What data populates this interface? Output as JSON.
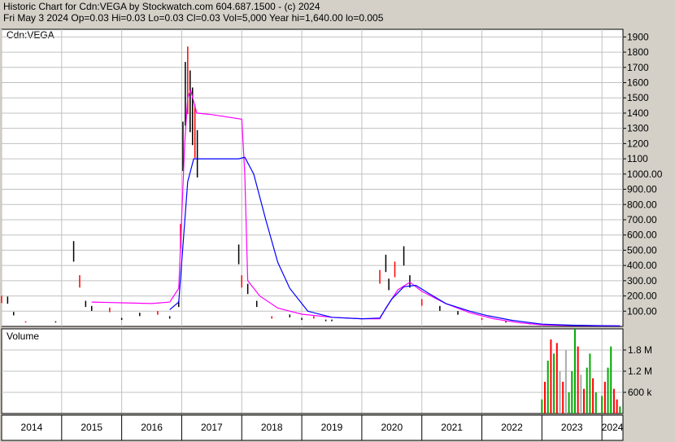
{
  "header": {
    "line1": "Historic Chart for Cdn:VEGA by Stockwatch.com 604.687.1500 - (c) 2024",
    "line2": "Fri May  3 2024   Op=0.03  Hi=0.03  Lo=0.03  Cl=0.03  Vol=5,000   Year hi=1,640.00  lo=0.005"
  },
  "colors": {
    "page_bg": "#d4d0c8",
    "plot_bg": "#ffffff",
    "grid": "#c0c0c0",
    "price_bar": "#000000",
    "price_bar_down": "#ff0000",
    "ma_short": "#ff00ff",
    "ma_long": "#0000ff",
    "volume_up": "#00aa00",
    "volume_down": "#ff0000",
    "volume_flat": "#aaaaaa"
  },
  "chart_data": [
    {
      "type": "line",
      "title": "Cdn:VEGA",
      "x_tick_labels": [
        "2014",
        "2015",
        "2016",
        "2017",
        "2018",
        "2019",
        "2020",
        "2021",
        "2022",
        "2023",
        "2024"
      ],
      "x_range": [
        2014.0,
        2024.35
      ],
      "y_tick_labels": [
        "1900",
        "1800",
        "1700",
        "1600",
        "1500",
        "1400",
        "1300",
        "1200",
        "1100",
        "1000.00",
        "900.00",
        "800.00",
        "700.00",
        "600.00",
        "500.00",
        "400.00",
        "300.00",
        "200.00",
        "100.00"
      ],
      "ylim": [
        0,
        1950
      ],
      "grid": true,
      "series": [
        {
          "style": "ohlc-bars",
          "points": [
            [
              2014.0,
              180
            ],
            [
              2014.1,
              175
            ],
            [
              2014.2,
              85
            ],
            [
              2014.4,
              30
            ],
            [
              2014.9,
              30
            ],
            [
              2015.2,
              500
            ],
            [
              2015.3,
              300
            ],
            [
              2015.4,
              150
            ],
            [
              2015.5,
              120
            ],
            [
              2015.8,
              110
            ],
            [
              2016.0,
              50
            ],
            [
              2016.3,
              80
            ],
            [
              2016.6,
              90
            ],
            [
              2016.8,
              60
            ],
            [
              2016.95,
              150
            ],
            [
              2016.98,
              600
            ],
            [
              2017.02,
              1200
            ],
            [
              2017.06,
              1550
            ],
            [
              2017.1,
              1640
            ],
            [
              2017.14,
              1500
            ],
            [
              2017.18,
              1400
            ],
            [
              2017.22,
              1300
            ],
            [
              2017.26,
              1150
            ],
            [
              2017.95,
              480
            ],
            [
              2018.0,
              300
            ],
            [
              2018.1,
              250
            ],
            [
              2018.25,
              150
            ],
            [
              2018.5,
              60
            ],
            [
              2018.8,
              70
            ],
            [
              2019.0,
              50
            ],
            [
              2019.2,
              60
            ],
            [
              2019.4,
              40
            ],
            [
              2019.5,
              40
            ],
            [
              2020.3,
              330
            ],
            [
              2020.4,
              420
            ],
            [
              2020.45,
              280
            ],
            [
              2020.55,
              380
            ],
            [
              2020.7,
              470
            ],
            [
              2020.8,
              300
            ],
            [
              2021.0,
              160
            ],
            [
              2021.3,
              120
            ],
            [
              2021.6,
              90
            ],
            [
              2022.0,
              50
            ],
            [
              2022.4,
              30
            ],
            [
              2022.8,
              15
            ],
            [
              2023.2,
              8
            ],
            [
              2023.8,
              5
            ],
            [
              2024.3,
              3
            ]
          ]
        },
        {
          "style": "line",
          "points": [
            [
              2015.5,
              160
            ],
            [
              2016.0,
              155
            ],
            [
              2016.5,
              150
            ],
            [
              2016.8,
              160
            ],
            [
              2016.95,
              250
            ],
            [
              2017.05,
              1200
            ],
            [
              2017.1,
              1500
            ],
            [
              2017.15,
              1550
            ],
            [
              2017.25,
              1400
            ],
            [
              2017.5,
              1390
            ],
            [
              2018.0,
              1360
            ],
            [
              2018.05,
              1000
            ],
            [
              2018.1,
              300
            ],
            [
              2018.3,
              200
            ],
            [
              2018.6,
              120
            ],
            [
              2019.0,
              80
            ],
            [
              2019.5,
              60
            ],
            [
              2020.0,
              50
            ],
            [
              2020.3,
              50
            ],
            [
              2020.4,
              120
            ],
            [
              2020.6,
              240
            ],
            [
              2020.8,
              290
            ],
            [
              2021.0,
              230
            ],
            [
              2021.4,
              150
            ],
            [
              2021.8,
              90
            ],
            [
              2022.2,
              50
            ],
            [
              2022.6,
              25
            ],
            [
              2023.0,
              10
            ],
            [
              2023.5,
              6
            ],
            [
              2024.0,
              4
            ],
            [
              2024.3,
              3
            ]
          ]
        },
        {
          "style": "line",
          "points": [
            [
              2016.8,
              110
            ],
            [
              2016.95,
              160
            ],
            [
              2017.1,
              950
            ],
            [
              2017.2,
              1100
            ],
            [
              2017.6,
              1100
            ],
            [
              2017.95,
              1100
            ],
            [
              2018.05,
              1110
            ],
            [
              2018.2,
              1000
            ],
            [
              2018.4,
              700
            ],
            [
              2018.6,
              420
            ],
            [
              2018.8,
              250
            ],
            [
              2019.1,
              100
            ],
            [
              2019.5,
              60
            ],
            [
              2020.0,
              50
            ],
            [
              2020.3,
              55
            ],
            [
              2020.5,
              180
            ],
            [
              2020.7,
              260
            ],
            [
              2020.9,
              270
            ],
            [
              2021.1,
              220
            ],
            [
              2021.4,
              150
            ],
            [
              2021.8,
              100
            ],
            [
              2022.1,
              70
            ],
            [
              2022.5,
              40
            ],
            [
              2023.0,
              15
            ],
            [
              2023.5,
              8
            ],
            [
              2024.0,
              5
            ],
            [
              2024.3,
              4
            ]
          ]
        }
      ]
    },
    {
      "type": "bar",
      "title": "Volume",
      "y_tick_labels": [
        "1.8 M",
        "1.2 M",
        "600 k"
      ],
      "ylim": [
        0,
        2400000
      ],
      "bars": [
        [
          2023.0,
          400000,
          "up"
        ],
        [
          2023.05,
          900000,
          "down"
        ],
        [
          2023.1,
          1500000,
          "up"
        ],
        [
          2023.15,
          2100000,
          "down"
        ],
        [
          2023.2,
          1700000,
          "up"
        ],
        [
          2023.25,
          2000000,
          "down"
        ],
        [
          2023.3,
          1200000,
          "flat"
        ],
        [
          2023.35,
          900000,
          "down"
        ],
        [
          2023.4,
          1800000,
          "flat"
        ],
        [
          2023.45,
          600000,
          "up"
        ],
        [
          2023.5,
          1200000,
          "up"
        ],
        [
          2023.55,
          2400000,
          "up"
        ],
        [
          2023.6,
          1900000,
          "down"
        ],
        [
          2023.65,
          1100000,
          "flat"
        ],
        [
          2023.7,
          700000,
          "down"
        ],
        [
          2023.75,
          1300000,
          "up"
        ],
        [
          2023.8,
          1700000,
          "up"
        ],
        [
          2023.85,
          1000000,
          "down"
        ],
        [
          2023.9,
          600000,
          "up"
        ],
        [
          2024.0,
          500000,
          "up"
        ],
        [
          2024.05,
          900000,
          "down"
        ],
        [
          2024.1,
          1300000,
          "up"
        ],
        [
          2024.15,
          1900000,
          "up"
        ],
        [
          2024.2,
          700000,
          "down"
        ],
        [
          2024.25,
          400000,
          "down"
        ],
        [
          2024.3,
          200000,
          "up"
        ]
      ]
    }
  ]
}
